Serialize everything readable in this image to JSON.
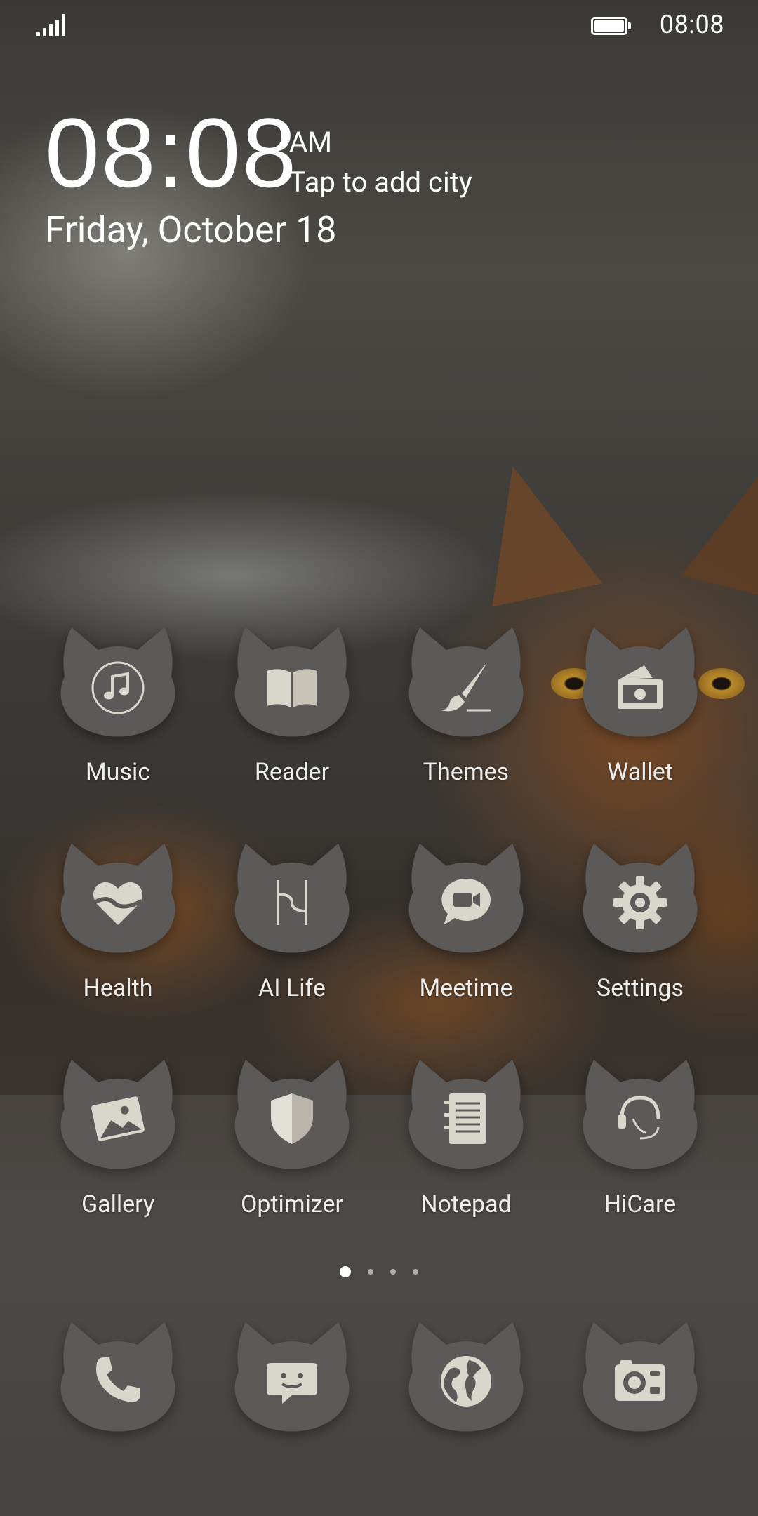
{
  "status_bar": {
    "time": "08:08",
    "battery_level": 1.0,
    "signal_bars": 4
  },
  "clock_widget": {
    "time": "08:08",
    "ampm": "AM",
    "city_prompt": "Tap to add city",
    "date": "Friday, October 18"
  },
  "apps": [
    {
      "label": "Music",
      "icon": "music-note-icon"
    },
    {
      "label": "Reader",
      "icon": "book-icon"
    },
    {
      "label": "Themes",
      "icon": "paintbrush-icon"
    },
    {
      "label": "Wallet",
      "icon": "wallet-icon"
    },
    {
      "label": "Health",
      "icon": "heart-icon"
    },
    {
      "label": "AI Life",
      "icon": "ai-life-icon"
    },
    {
      "label": "Meetime",
      "icon": "video-call-icon"
    },
    {
      "label": "Settings",
      "icon": "gear-icon"
    },
    {
      "label": "Gallery",
      "icon": "picture-icon"
    },
    {
      "label": "Optimizer",
      "icon": "shield-icon"
    },
    {
      "label": "Notepad",
      "icon": "notepad-icon"
    },
    {
      "label": "HiCare",
      "icon": "headset-icon"
    }
  ],
  "page_indicator": {
    "pages": 4,
    "current": 1
  },
  "dock": [
    {
      "name": "phone",
      "icon": "phone-icon"
    },
    {
      "name": "messages",
      "icon": "message-icon"
    },
    {
      "name": "browser",
      "icon": "globe-icon"
    },
    {
      "name": "camera",
      "icon": "camera-icon"
    }
  ],
  "colors": {
    "icon_badge": "#5b5a58",
    "icon_glyph": "#d9d6cc",
    "label": "#eeeeec"
  }
}
